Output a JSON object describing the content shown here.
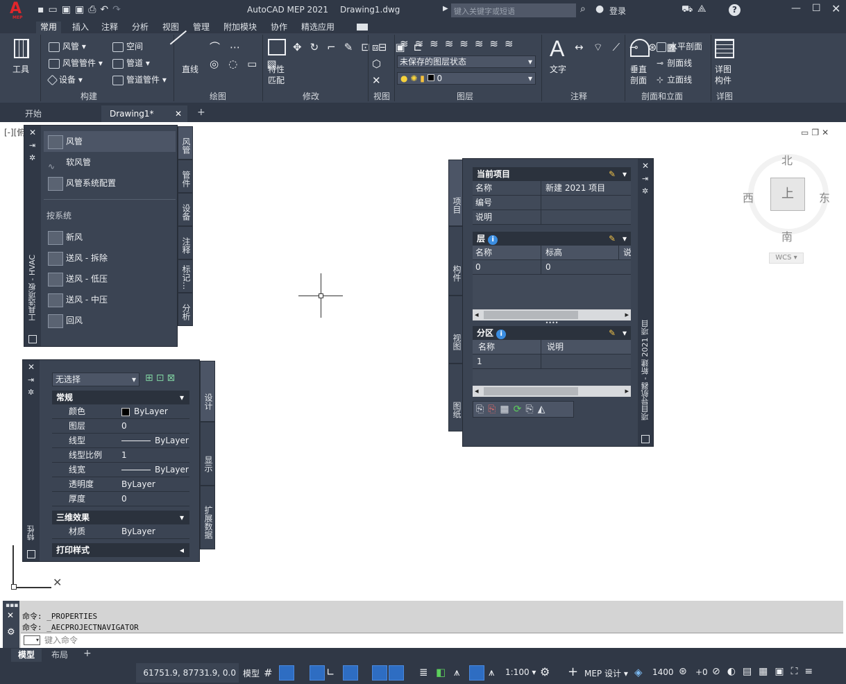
{
  "app": {
    "logo": "A",
    "logo_sub": "MEP",
    "title": "AutoCAD MEP 2021",
    "filename": "Drawing1.dwg"
  },
  "search": {
    "placeholder": "键入关键字或短语"
  },
  "user": {
    "login": "登录"
  },
  "ribbon_tabs": [
    "常用",
    "插入",
    "注释",
    "分析",
    "视图",
    "管理",
    "附加模块",
    "协作",
    "精选应用"
  ],
  "ribbon": {
    "tools": "工具",
    "build": {
      "duct": "风管",
      "duct_fitting": "风管管件",
      "equipment": "设备",
      "space": "空间",
      "pipe": "管道",
      "pipe_fitting": "管道管件",
      "title": "构建"
    },
    "draw": {
      "line": "直线",
      "title": "绘图"
    },
    "modify": {
      "match": "特性\n匹配",
      "match1": "特性",
      "match2": "匹配",
      "title": "修改"
    },
    "view": {
      "title": "视图"
    },
    "layers": {
      "state": "未保存的图层状态",
      "layer": "0",
      "title": "图层"
    },
    "annotation": {
      "text": "文字",
      "title": "注释"
    },
    "section": {
      "vertical1": "垂直",
      "vertical2": "剖面",
      "horizontal": "水平剖面",
      "section_line": "剖面线",
      "elevation_line": "立面线",
      "title": "剖面和立面"
    },
    "detail": {
      "detail1": "详图",
      "detail2": "构件",
      "title": "详图"
    }
  },
  "doc_tabs": [
    "开始",
    "Drawing1*"
  ],
  "viewport_label": "[-][俯",
  "viewcube": {
    "north": "北",
    "south": "南",
    "east": "东",
    "west": "西",
    "top": "上",
    "wcs": "WCS"
  },
  "tool_palette": {
    "title": "工具选项板 - HVAC",
    "items": [
      "风管",
      "软风管",
      "风管系统配置"
    ],
    "section": "按系统",
    "system_items": [
      "新风",
      "送风 - 拆除",
      "送风 - 低压",
      "送风 - 中压",
      "回风"
    ],
    "tabs": [
      "风管",
      "管件",
      "设备",
      "注释",
      "标记...",
      "分析"
    ]
  },
  "properties": {
    "title": "特性",
    "selection": "无选择",
    "general": "常规",
    "rows": [
      {
        "k": "颜色",
        "v": "ByLayer"
      },
      {
        "k": "图层",
        "v": "0"
      },
      {
        "k": "线型",
        "v": "ByLayer"
      },
      {
        "k": "线型比例",
        "v": "1"
      },
      {
        "k": "线宽",
        "v": "ByLayer"
      },
      {
        "k": "透明度",
        "v": "ByLayer"
      },
      {
        "k": "厚度",
        "v": "0"
      }
    ],
    "effects3d": "三维效果",
    "material_k": "材质",
    "material_v": "ByLayer",
    "print_style": "打印样式",
    "tabs": [
      "设计",
      "显示",
      "扩展数据"
    ]
  },
  "navigator": {
    "title": "项目导航器 - 新建 2021 项目",
    "current": "当前项目",
    "name_k": "名称",
    "name_v": "新建 2021 项目",
    "number_k": "编号",
    "desc_k": "说明",
    "levels": "层",
    "levels_cols": [
      "名称",
      "标高",
      "说"
    ],
    "levels_row": [
      "0",
      "0"
    ],
    "divisions": "分区",
    "div_cols": [
      "名称",
      "说明"
    ],
    "div_row": [
      "1"
    ],
    "tabs": [
      "项目",
      "构件",
      "视图",
      "图纸"
    ]
  },
  "command": {
    "line1": "命令: _PROPERTIES",
    "line2": "命令: _AECPROJECTNAVIGATOR",
    "placeholder": "键入命令"
  },
  "layout_tabs": [
    "模型",
    "布局"
  ],
  "status": {
    "coords": "61751.9, 87731.9, 0.0",
    "model": "模型",
    "scale": "1:100",
    "workspace": "MEP 设计",
    "elevation": "1400",
    "offset": "+0"
  }
}
